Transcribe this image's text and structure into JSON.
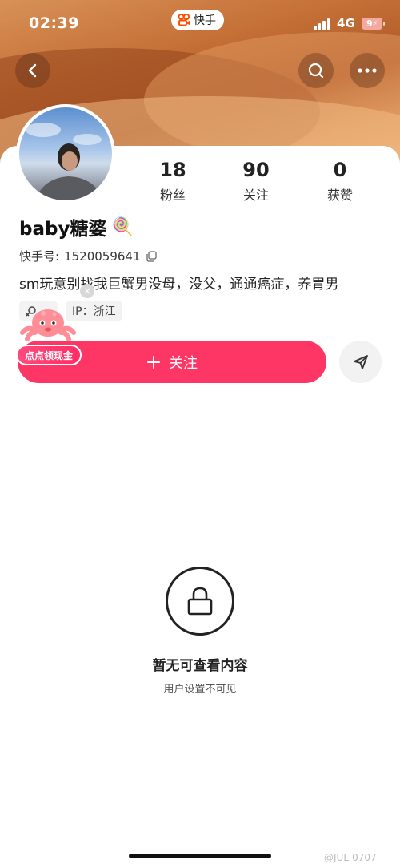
{
  "status_bar": {
    "time": "02:39",
    "app_name": "快手",
    "network": "4G",
    "battery": "9"
  },
  "nav": {
    "back_icon": "chevron-left-icon",
    "search_icon": "search-icon",
    "more_icon": "more-horizontal-icon"
  },
  "profile": {
    "stats": [
      {
        "value": "18",
        "label": "粉丝"
      },
      {
        "value": "90",
        "label": "关注"
      },
      {
        "value": "0",
        "label": "获赞"
      }
    ],
    "name": "baby糖婆",
    "name_emoji": "🍭",
    "kuaishou_id_label": "快手号:",
    "kuaishou_id": "1520059641",
    "bio": "sm玩意别找我巨蟹男没母，没父，通通癌症，养胃男",
    "tags": [
      {
        "icon": "gender-icon",
        "label": ""
      },
      {
        "label": "IP：浙江"
      }
    ]
  },
  "promo": {
    "badge_label": "点点领现金",
    "close_label": "×"
  },
  "actions": {
    "follow_label": "关注",
    "follow_icon": "plus-icon",
    "message_icon": "send-icon"
  },
  "empty_state": {
    "icon": "lock-icon",
    "title": "暂无可查看内容",
    "subtitle": "用户设置不可见"
  },
  "watermark": "@JUL-0707",
  "colors": {
    "accent": "#fe3666",
    "banner": "#c46f36"
  }
}
